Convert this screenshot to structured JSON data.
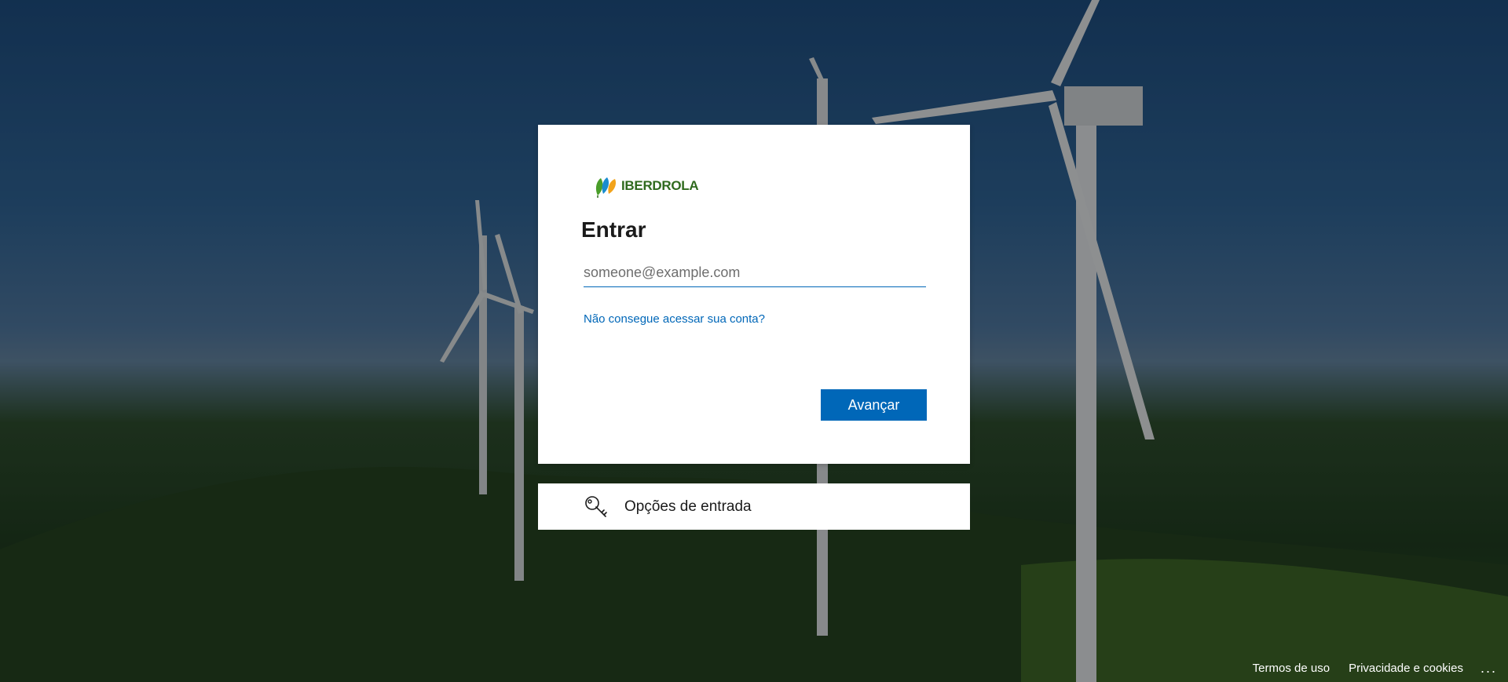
{
  "brand": {
    "logo_text": "IBERDROLA",
    "logo_icon": "iberdrola-leaves-logo"
  },
  "signin": {
    "title": "Entrar",
    "email_placeholder": "someone@example.com",
    "email_value": "",
    "help_link": "Não consegue acessar sua conta?",
    "next_button": "Avançar"
  },
  "options": {
    "icon": "key-icon",
    "label": "Opções de entrada"
  },
  "footer": {
    "terms": "Termos de uso",
    "privacy": "Privacidade e cookies",
    "more": "..."
  },
  "colors": {
    "accent": "#0067b8",
    "brand_green": "#2f6a1e"
  }
}
